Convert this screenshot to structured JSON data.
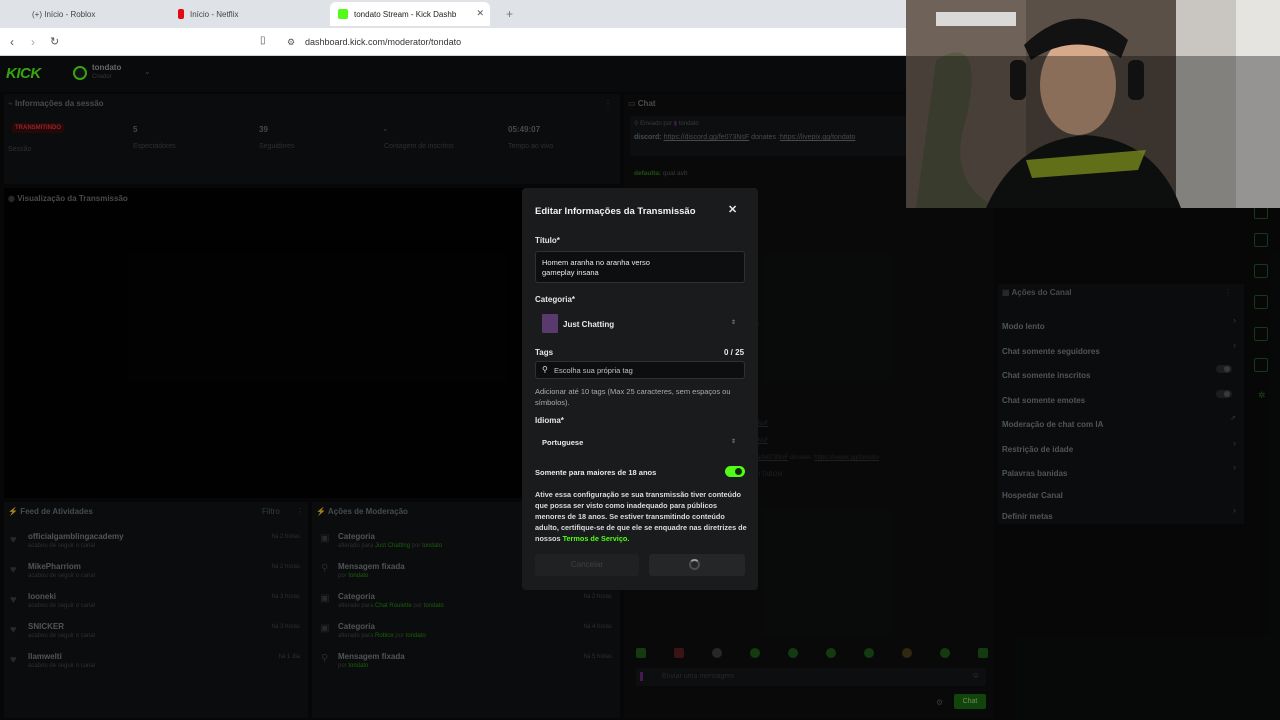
{
  "browser": {
    "tabs": [
      {
        "title": "(+) Início - Roblox",
        "color": "#3a6fd8"
      },
      {
        "title": "Início - Netflix",
        "color": "#e50914"
      },
      {
        "title": "tondato Stream - Kick Dashb",
        "color": "#53fc18"
      }
    ],
    "url": "dashboard.kick.com/moderator/tondato"
  },
  "topnav": {
    "logo": "KICK",
    "channel_name": "tondato",
    "channel_role": "Criador"
  },
  "session": {
    "title": "Informações da sessão",
    "status_badge": "TRANSMITINDO",
    "status_label": "Sessão",
    "stats": [
      {
        "value": "5",
        "label": "Espectadores"
      },
      {
        "value": "39",
        "label": "Seguidores"
      },
      {
        "value": "-",
        "label": "Contagem de inscritos"
      },
      {
        "value": "05:49:07",
        "label": "Tempo ao vivo"
      }
    ]
  },
  "preview": {
    "title": "Visualização da Transmissão"
  },
  "activity": {
    "title": "Feed de Atividades",
    "filter": "Filtro",
    "items": [
      {
        "name": "officialgamblingacademy",
        "sub": "acabou de seguir o canal",
        "time": "há 2 horas"
      },
      {
        "name": "MikePharriom",
        "sub": "acabou de seguir o canal",
        "time": "há 2 horas"
      },
      {
        "name": "looneki",
        "sub": "acabou de seguir o canal",
        "time": "há 3 horas"
      },
      {
        "name": "SNICKER",
        "sub": "acabou de seguir o canal",
        "time": "há 3 horas"
      },
      {
        "name": "llamwelti",
        "sub": "acabou de seguir o canal",
        "time": "há 1 dia"
      }
    ]
  },
  "moderation": {
    "title": "Ações de Moderação",
    "items": [
      {
        "title": "Categoria",
        "pre": "alterado para",
        "link": "Just Chatting",
        "mid": "por",
        "user": "tondato",
        "time": ""
      },
      {
        "title": "Mensagem fixada",
        "pre": "por",
        "link": "",
        "mid": "",
        "user": "tondato",
        "time": ""
      },
      {
        "title": "Categoria",
        "pre": "alterado para",
        "link": "Chat Roulette",
        "mid": "por",
        "user": "tondato",
        "time": "há 2 horas"
      },
      {
        "title": "Categoria",
        "pre": "alterado para",
        "link": "Roblox",
        "mid": "por",
        "user": "tondato",
        "time": "há 4 horas"
      },
      {
        "title": "Mensagem fixada",
        "pre": "por",
        "link": "",
        "mid": "",
        "user": "tondato",
        "time": "há 5 horas"
      }
    ]
  },
  "chat": {
    "title": "Chat",
    "pinned_by": "Enviado por",
    "pinned_user": "tondato",
    "pinned_msg_user": "discord:",
    "pinned_link1": "https://discord.gg/fe073NsF",
    "pinned_mid": "donates :",
    "pinned_link2": "https://livepix.gg/tondato",
    "msg1_user": "defaulta:",
    "msg1_text": "qual avb",
    "bg_frag1": "3NsF",
    "bg_frag2": "3NsF",
    "bg_frag3": "ve/fe073NsF",
    "bg_frag4": "donates :",
    "bg_frag5": "https://livepix.gg/tondato",
    "bg_frag6": "UI TABOM",
    "bg_frag7": "ib",
    "input_placeholder": "Enviar uma mensagem",
    "send_button": "Chat"
  },
  "channel_actions": {
    "title": "Ações do Canal",
    "items": [
      {
        "label": "Modo lento",
        "ctl": "chev"
      },
      {
        "label": "Chat somente seguidores",
        "ctl": "chev"
      },
      {
        "label": "Chat somente inscritos",
        "ctl": "toggle"
      },
      {
        "label": "Chat somente emotes",
        "ctl": "toggle"
      },
      {
        "label": "Moderação de chat com IA",
        "ctl": "ext"
      },
      {
        "label": "Restrição de idade",
        "ctl": "chev"
      },
      {
        "label": "Palavras banidas",
        "ctl": "chev"
      },
      {
        "label": "Hospedar Canal",
        "ctl": "none"
      },
      {
        "label": "Definir metas",
        "ctl": "chev"
      }
    ]
  },
  "modal": {
    "title": "Editar Informações da Transmissão",
    "title_label": "Título*",
    "title_line1": "Homem aranha no aranha verso",
    "title_line2": "gameplay insana",
    "category_label": "Categoria*",
    "category_value": "Just Chatting",
    "tags_label": "Tags",
    "tags_count": "0 / 25",
    "tags_placeholder": "Escolha sua própria tag",
    "tags_help": "Adicionar até 10 tags (Max 25 caracteres, sem espaços ou símbolos).",
    "language_label": "Idioma*",
    "language_value": "Portuguese",
    "adult_label": "Somente para maiores de 18 anos",
    "adult_enabled": true,
    "adult_help": "Ative essa configuração se sua transmissão tiver conteúdo que possa ser visto como inadequado para públicos menores de 18 anos. Se estiver transmitindo conteúdo adulto, certifique-se de que ele se enquadre nas diretrizes de nossos",
    "terms_link": "Termos de Serviço.",
    "cancel_button": "Cancelar"
  }
}
